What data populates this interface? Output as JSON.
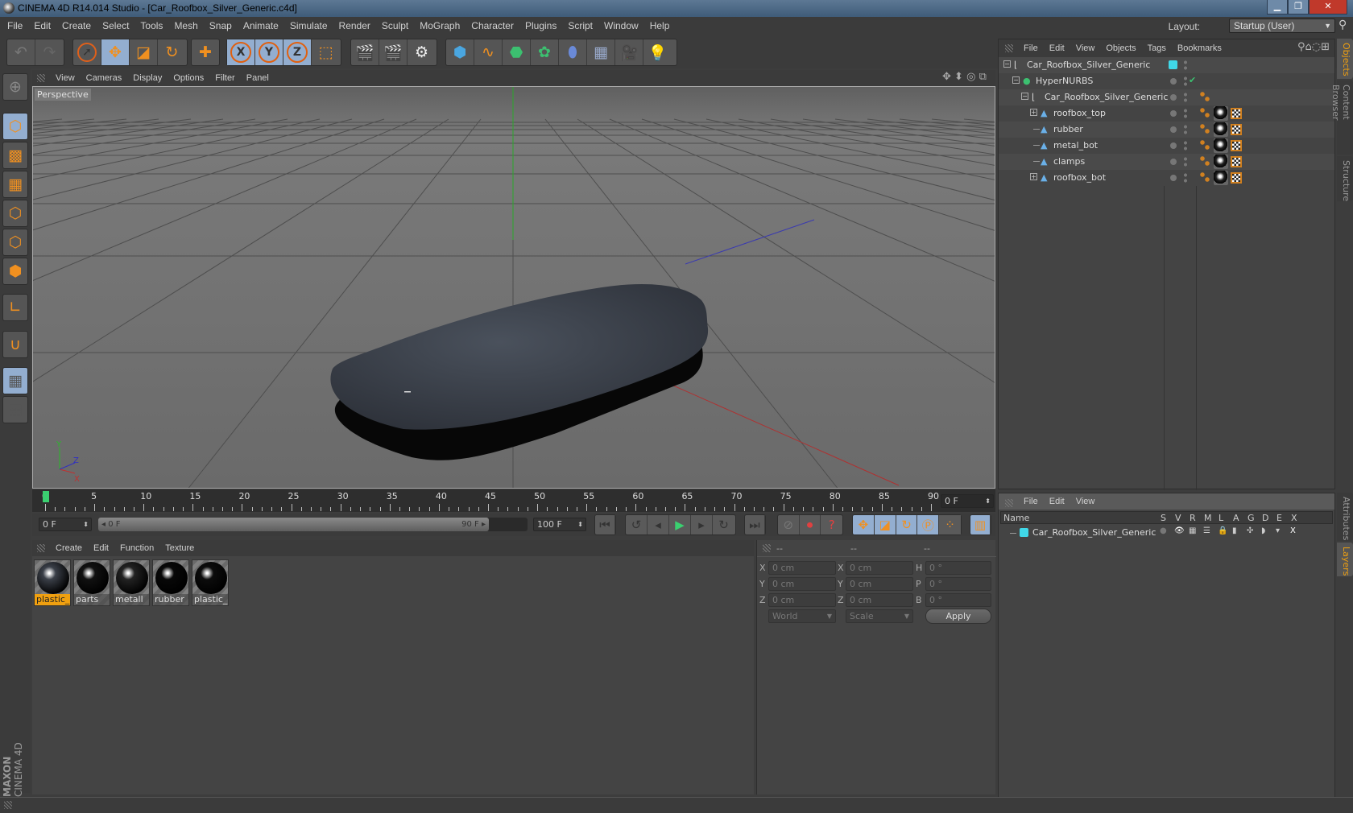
{
  "window": {
    "title": "CINEMA 4D R14.014 Studio - [Car_Roofbox_Silver_Generic.c4d]",
    "controls": [
      "minimize",
      "restore",
      "close"
    ]
  },
  "menubar": {
    "items": [
      "File",
      "Edit",
      "Create",
      "Select",
      "Tools",
      "Mesh",
      "Snap",
      "Animate",
      "Simulate",
      "Render",
      "Sculpt",
      "MoGraph",
      "Character",
      "Plugins",
      "Script",
      "Window",
      "Help"
    ],
    "layout_label": "Layout:",
    "layout_value": "Startup (User)"
  },
  "toolbar": {
    "groups": [
      {
        "name": "history",
        "tools": [
          "undo-icon",
          "redo-icon"
        ]
      },
      {
        "name": "transform",
        "tools": [
          "live-selection-icon",
          "move-icon",
          "scale-icon",
          "rotate-icon"
        ]
      },
      {
        "name": "recent",
        "tools": [
          "add-tool-icon"
        ]
      },
      {
        "name": "axis",
        "tools": [
          "x-axis-lock-icon",
          "y-axis-lock-icon",
          "z-axis-lock-icon",
          "coordinate-system-icon"
        ]
      },
      {
        "name": "render",
        "tools": [
          "render-view-icon",
          "render-picture-viewer-icon",
          "render-settings-icon"
        ]
      },
      {
        "name": "create",
        "tools": [
          "cube-primitive-icon",
          "spline-pen-icon",
          "subdivision-surface-icon",
          "array-icon",
          "deformer-icon",
          "floor-icon",
          "camera-icon",
          "light-icon"
        ]
      }
    ]
  },
  "left_tools": [
    "make-editable-icon",
    "model-mode-icon",
    "texture-mode-icon",
    "workplane-mode-icon",
    "points-mode-icon",
    "edges-mode-icon",
    "polygons-mode-icon",
    "axis-mode-icon",
    "snap-magnet-icon",
    "locked-workplane-icon",
    "planar-workplane-icon"
  ],
  "branding": {
    "line1": "MAXON",
    "line2": "CINEMA 4D"
  },
  "viewport": {
    "menu": [
      "View",
      "Cameras",
      "Display",
      "Options",
      "Filter",
      "Panel"
    ],
    "label": "Perspective",
    "axes": {
      "x": "X",
      "y": "Y",
      "z": "Z"
    },
    "nav_icons": [
      "pan-icon",
      "dolly-icon",
      "orbit-icon",
      "maximize-view-icon"
    ]
  },
  "timeline": {
    "ticks": [
      "0",
      "5",
      "10",
      "15",
      "20",
      "25",
      "30",
      "35",
      "40",
      "45",
      "50",
      "55",
      "60",
      "65",
      "70",
      "75",
      "80",
      "85",
      "90"
    ],
    "current_frame": "0 F",
    "start_field": "0 F",
    "range_start": "0 F",
    "range_end": "90 F",
    "end_field": "100 F",
    "playhead_frame": 0
  },
  "playback": {
    "buttons": [
      "go-to-start-icon",
      "previous-key-icon",
      "previous-frame-icon",
      "play-icon",
      "next-frame-icon",
      "next-key-icon",
      "go-to-end-icon",
      "motion-record-icon",
      "record-active-icon",
      "autokey-icon",
      "key-position-icon",
      "key-scale-icon",
      "key-rotation-icon",
      "key-parameter-icon",
      "key-pla-icon",
      "timeline-icon"
    ]
  },
  "materials": {
    "menu": [
      "Create",
      "Edit",
      "Function",
      "Texture"
    ],
    "items": [
      {
        "label": "plastic_s",
        "selected": true,
        "tone": "#3a3f48"
      },
      {
        "label": "parts",
        "selected": false,
        "tone": "#111"
      },
      {
        "label": "metall",
        "selected": false,
        "tone": "#222"
      },
      {
        "label": "rubber",
        "selected": false,
        "tone": "#080808"
      },
      {
        "label": "plastic_b",
        "selected": false,
        "tone": "#0c0c0c"
      }
    ]
  },
  "coordinates": {
    "headers": [
      "--",
      "--",
      "--"
    ],
    "rows": [
      {
        "a_label": "X",
        "a_value": "0 cm",
        "b_label": "X",
        "b_value": "0 cm",
        "c_label": "H",
        "c_value": "0 °"
      },
      {
        "a_label": "Y",
        "a_value": "0 cm",
        "b_label": "Y",
        "b_value": "0 cm",
        "c_label": "P",
        "c_value": "0 °"
      },
      {
        "a_label": "Z",
        "a_value": "0 cm",
        "b_label": "Z",
        "b_value": "0 cm",
        "c_label": "B",
        "c_value": "0 °"
      }
    ],
    "mode_select": "World",
    "type_select": "Scale",
    "apply_label": "Apply"
  },
  "objects_panel": {
    "menu": [
      "File",
      "Edit",
      "View",
      "Objects",
      "Tags",
      "Bookmarks"
    ],
    "items": [
      {
        "name": "Car_Roofbox_Silver_Generic",
        "type": "null",
        "depth": 0,
        "expander": "minus"
      },
      {
        "name": "HyperNURBS",
        "type": "hypernurbs",
        "depth": 1,
        "expander": "minus",
        "check": "✔"
      },
      {
        "name": "Car_Roofbox_Silver_Generic",
        "type": "null",
        "depth": 2,
        "expander": "minus"
      },
      {
        "name": "roofbox_top",
        "type": "polygon",
        "depth": 3,
        "expander": "plus"
      },
      {
        "name": "rubber",
        "type": "polygon",
        "depth": 3,
        "expander": "none"
      },
      {
        "name": "metal_bot",
        "type": "polygon",
        "depth": 3,
        "expander": "none"
      },
      {
        "name": "clamps",
        "type": "polygon",
        "depth": 3,
        "expander": "none"
      },
      {
        "name": "roofbox_bot",
        "type": "polygon",
        "depth": 3,
        "expander": "plus"
      }
    ],
    "layer_color": "#40d8e8"
  },
  "layers_panel": {
    "menu": [
      "File",
      "Edit",
      "View"
    ],
    "columns": [
      "Name",
      "S",
      "V",
      "R",
      "M",
      "L",
      "A",
      "G",
      "D",
      "E",
      "X"
    ],
    "rows": [
      {
        "name": "Car_Roofbox_Silver_Generic",
        "color": "#40d8e8"
      }
    ]
  },
  "side_tabs": {
    "top": [
      {
        "label": "Objects",
        "active": true
      },
      {
        "label": "Content Browser",
        "active": false
      },
      {
        "label": "Structure",
        "active": false
      }
    ],
    "bottom": [
      {
        "label": "Attributes",
        "active": false
      },
      {
        "label": "Layers",
        "active": true
      }
    ]
  }
}
